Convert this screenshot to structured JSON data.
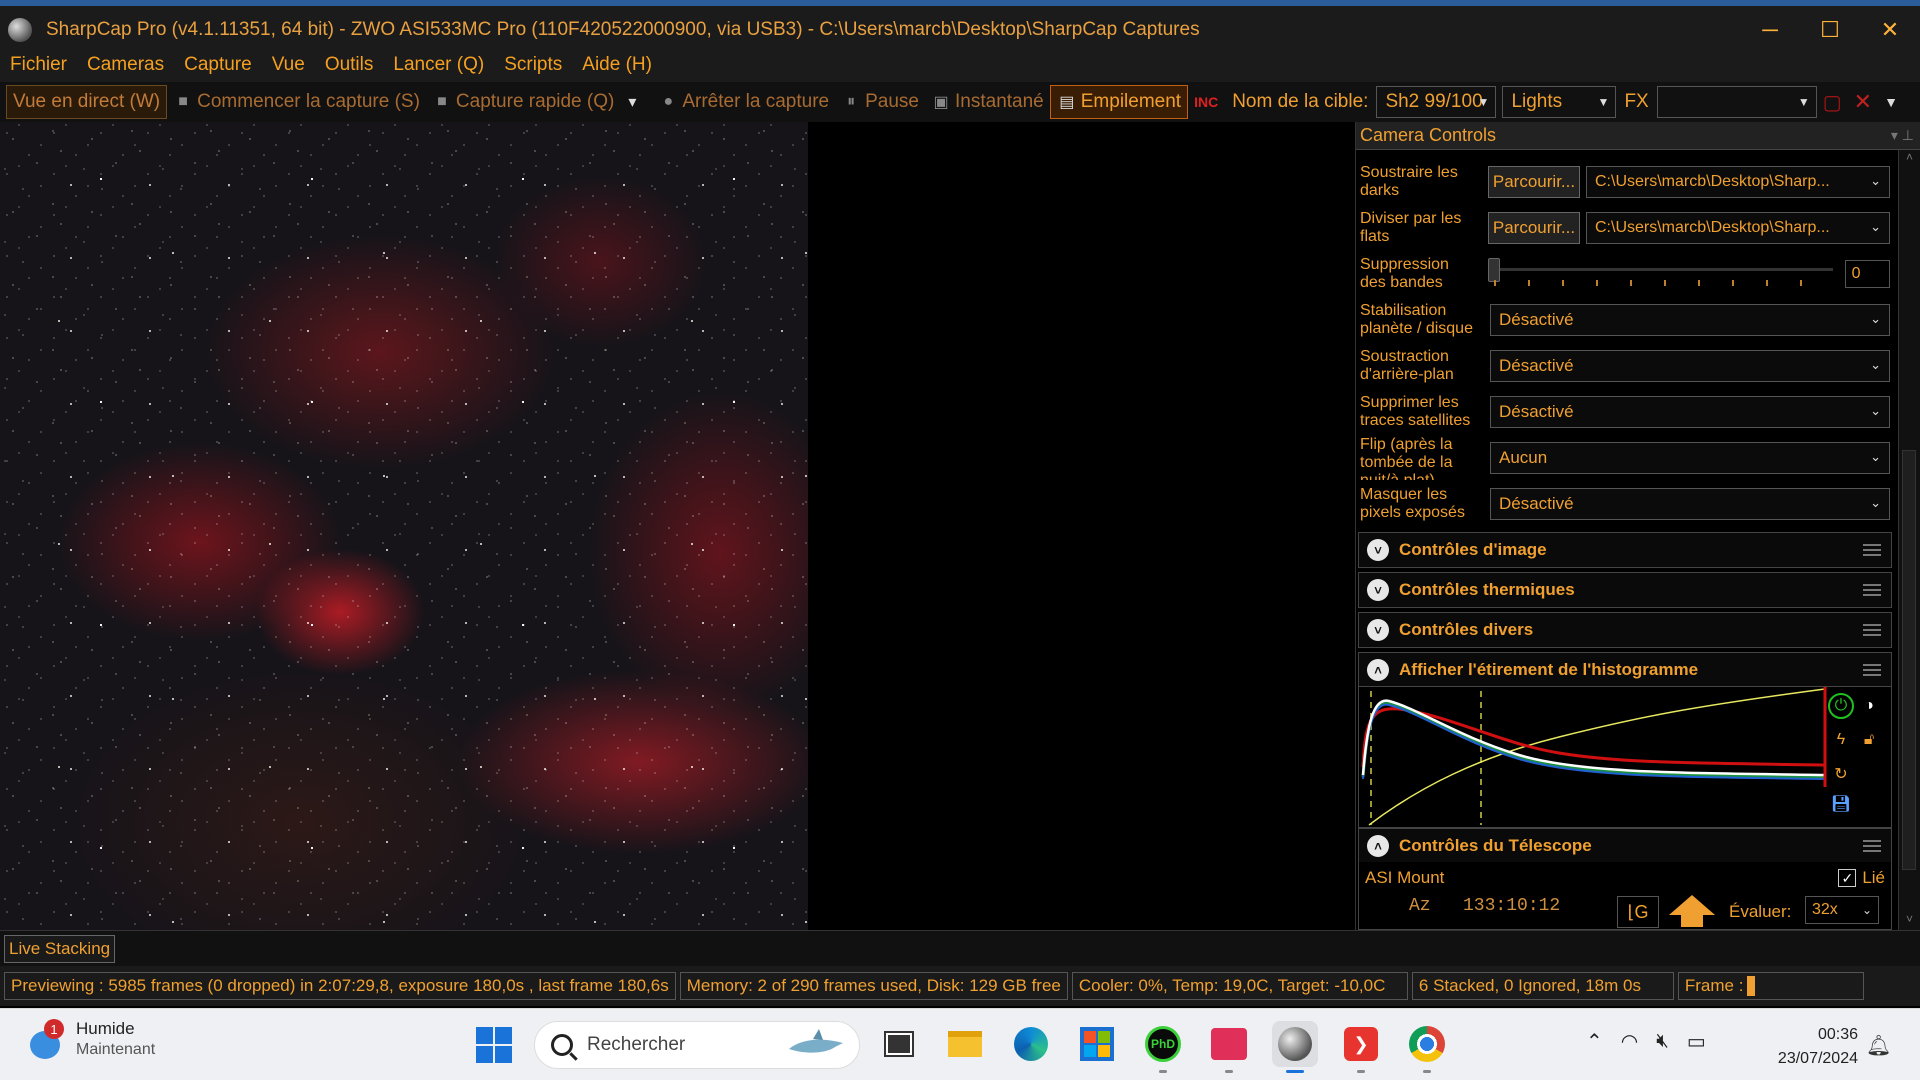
{
  "window": {
    "title": "SharpCap Pro (v4.1.11351, 64 bit) - ZWO ASI533MC Pro (110F420522000900, via USB3) - C:\\Users\\marcb\\Desktop\\SharpCap Captures",
    "controls": [
      "─",
      "☐",
      "✕"
    ]
  },
  "menu": [
    "Fichier",
    "Cameras",
    "Capture",
    "Vue",
    "Outils",
    "Lancer (Q)",
    "Scripts",
    "Aide (H)"
  ],
  "toolbar": {
    "live_view": "Vue en direct (W)",
    "start_capture": "Commencer la capture (S)",
    "quick_capture": "Capture rapide (Q)",
    "stop_capture": "Arrêter la capture",
    "pause": "Pause",
    "snapshot": "Instantané",
    "stacking": "Empilement",
    "target_label": "Nom de la cible:",
    "target_value": "Sh2 99/100",
    "frame_type": "Lights",
    "fx_label": "FX",
    "fx_value": ""
  },
  "panel": {
    "title": "Camera Controls",
    "rows": {
      "darks_label": "Soustraire les darks",
      "flats_label": "Diviser par les flats",
      "browse": "Parcourir...",
      "darks_path": "C:\\Users\\marcb\\Desktop\\Sharp...",
      "flats_path": "C:\\Users\\marcb\\Desktop\\Sharp...",
      "banding_label": "Suppression des bandes",
      "banding_value": "0",
      "stab_label": "Stabilisation planète / disque",
      "stab_value": "Désactivé",
      "bg_label": "Soustraction d'arrière-plan",
      "bg_value": "Désactivé",
      "sat_label": "Supprimer les traces satellites",
      "sat_value": "Désactivé",
      "flip_label": "Flip (après la tombée de la nuit/à plat)",
      "flip_value": "Aucun",
      "mask_label": "Masquer les pixels exposés",
      "mask_value": "Désactivé"
    },
    "sections": {
      "image": "Contrôles d'image",
      "thermal": "Contrôles thermiques",
      "misc": "Contrôles divers",
      "histogram": "Afficher l'étirement de l'histogramme",
      "telescope": "Contrôles du Télescope"
    },
    "telescope": {
      "mount": "ASI Mount",
      "linked": "Lié",
      "az": "Az   133:10:12",
      "evaluate_label": "Évaluer:",
      "evaluate_value": "32x"
    }
  },
  "tabs": {
    "live_stacking": "Live Stacking"
  },
  "status": {
    "preview": "Previewing : 5985 frames (0 dropped) in 2:07:29,8, exposure 180,0s , last frame 180,6s",
    "memory": "Memory: 2 of 290 frames used, Disk: 129 GB free",
    "cooler": "Cooler: 0%, Temp: 19,0C, Target: -10,0C",
    "stacked": "6 Stacked, 0 Ignored, 18m 0s",
    "frame": "Frame :"
  },
  "taskbar": {
    "weather_title": "Humide",
    "weather_sub": "Maintenant",
    "notification_count": "1",
    "search_placeholder": "Rechercher",
    "time": "00:36",
    "date": "23/07/2024"
  },
  "colors": {
    "accent": "#f0a030",
    "background": "#000000",
    "title_bar": "#1b1b1b"
  }
}
